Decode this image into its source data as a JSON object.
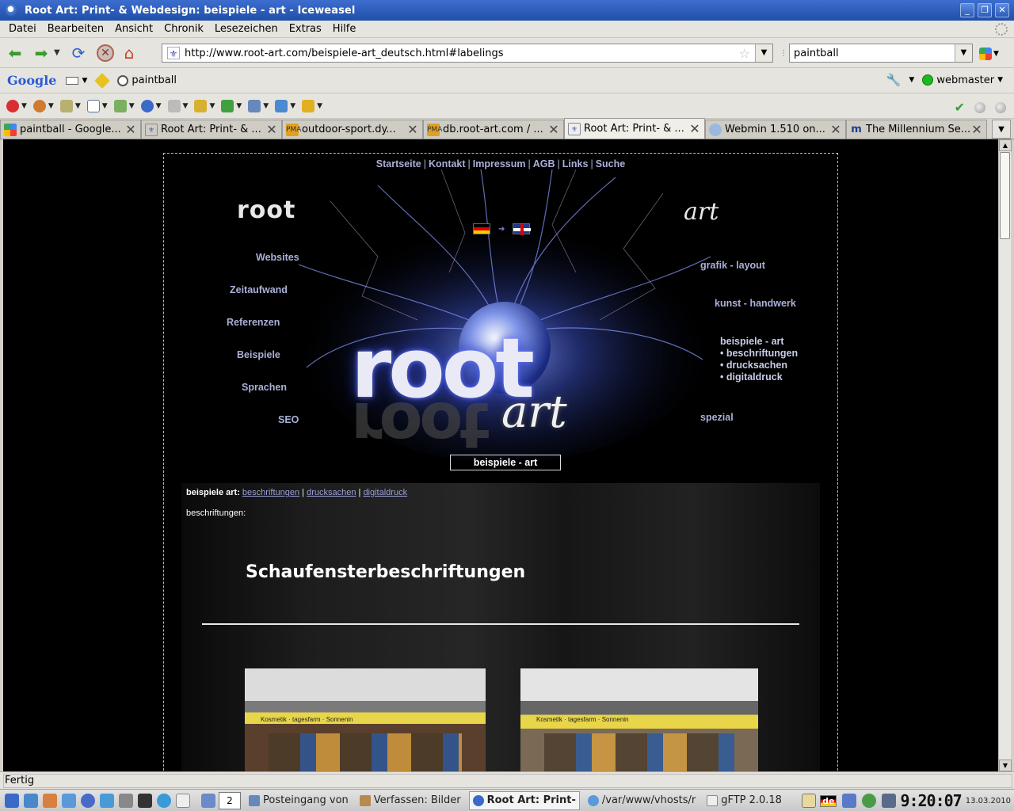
{
  "window": {
    "title": "Root Art: Print- & Webdesign: beispiele - art - Iceweasel",
    "controls": [
      "_",
      "❐",
      "✕"
    ]
  },
  "menubar": [
    "Datei",
    "Bearbeiten",
    "Ansicht",
    "Chronik",
    "Lesezeichen",
    "Extras",
    "Hilfe"
  ],
  "navbar": {
    "url": "http://www.root-art.com/beispiele-art_deutsch.html#labelings",
    "search_value": "paintball"
  },
  "google_toolbar": {
    "logo": "Google",
    "search_value": "paintball",
    "account": "webmaster"
  },
  "tabs": [
    {
      "label": "paintball - Google...",
      "icon": "google-icon",
      "active": false
    },
    {
      "label": "Root Art: Print- & ...",
      "icon": "site-icon",
      "active": false
    },
    {
      "label": "outdoor-sport.dy...",
      "icon": "pma-icon",
      "active": false
    },
    {
      "label": "db.root-art.com / ...",
      "icon": "pma-icon",
      "active": false
    },
    {
      "label": "Root Art: Print- & ...",
      "icon": "site-icon",
      "active": true
    },
    {
      "label": "Webmin 1.510 on...",
      "icon": "webmin-icon",
      "active": false
    },
    {
      "label": "The Millennium Se...",
      "icon": "millennium-icon",
      "active": false
    }
  ],
  "site": {
    "topnav": [
      "Startseite",
      "Kontakt",
      "Impressum",
      "AGB",
      "Links",
      "Suche"
    ],
    "logo_small_left": "root",
    "logo_small_right": "art",
    "big_logo_root": "root",
    "big_logo_art": "art",
    "left_links": [
      "Websites",
      "Zeitaufwand",
      "Referenzen",
      "Beispiele",
      "Sprachen",
      "SEO"
    ],
    "right_links": [
      "grafik - layout",
      "kunst - handwerk"
    ],
    "submenu": {
      "title": "beispiele - art",
      "items": [
        "• beschriftungen",
        "• drucksachen",
        "• digitaldruck"
      ]
    },
    "spezial": "spezial",
    "page_label": "beispiele - art",
    "crumbs": {
      "title": "beispiele art:",
      "links": [
        "beschriftungen",
        "drucksachen",
        "digitaldruck"
      ]
    },
    "section_label": "beschriftungen:",
    "heading": "Schaufensterbeschriftungen",
    "photo_text": "Kosmetik  ·  tagesfarm  ·  Sonnenin"
  },
  "statusbar": {
    "text": "Fertig"
  },
  "taskbar": {
    "pager": "2",
    "tasks": [
      {
        "label": "Posteingang von",
        "active": false
      },
      {
        "label": "Verfassen: Bilder",
        "active": false
      },
      {
        "label": "Root Art: Print-",
        "active": true
      },
      {
        "label": "/var/www/vhosts/r",
        "active": false
      },
      {
        "label": "gFTP 2.0.18",
        "active": false
      }
    ],
    "keyboard": "de",
    "clock": "9:20:07",
    "date": "13.03.2010"
  }
}
